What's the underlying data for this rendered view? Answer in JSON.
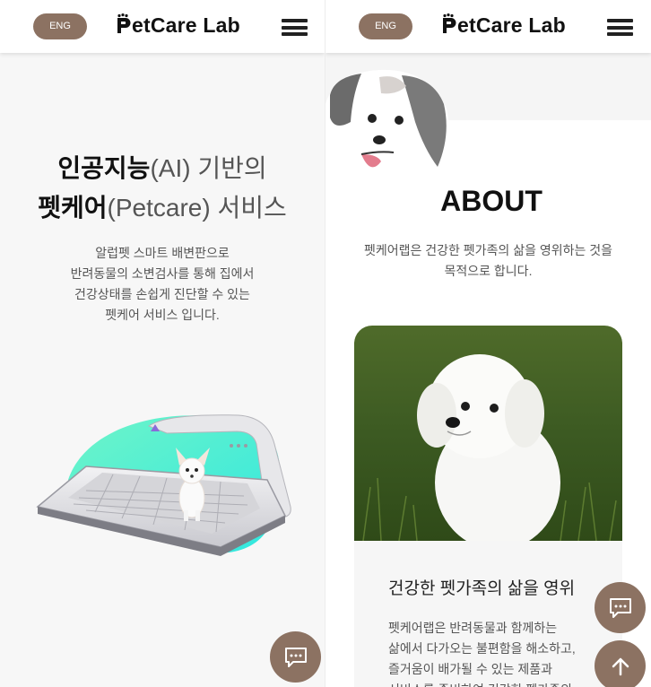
{
  "header": {
    "lang_label": "ENG",
    "logo_text": "PetCare Lab",
    "logo_rest": "etCare Lab"
  },
  "hero": {
    "title_line1_bold": "인공지능",
    "title_line1_light": "(AI) 기반의",
    "title_line2_bold": "펫케어",
    "title_line2_light": "(Petcare) 서비스",
    "description": [
      "알럽펫 스마트 배변판으로",
      "반려동물의 소변검사를 통해 집에서",
      "건강상태를 손쉽게 진단할 수 있는",
      "펫케어 서비스 입니다."
    ]
  },
  "about": {
    "title": "ABOUT",
    "description": [
      "펫케어랩은 건강한 펫가족의 삶을 영위하는 것을",
      "목적으로 합니다."
    ],
    "info_title": "건강한 펫가족의 삶을 영위",
    "info_text": [
      "펫케어랩은 반려동물과 함께하는",
      "삶에서 다가오는 불편함을 해소하고,",
      "즐거움이 배가될 수 있는 제품과",
      "서비스를 준비하여 건강한 펫가족의"
    ]
  },
  "colors": {
    "accent_brown": "#8c7262",
    "header_bg": "#ffffff",
    "mint": "#3ff0d0"
  },
  "icons": {
    "menu": "hamburger-icon",
    "chat": "chat-icon",
    "top": "arrow-up-icon",
    "paw": "paw-icon"
  }
}
